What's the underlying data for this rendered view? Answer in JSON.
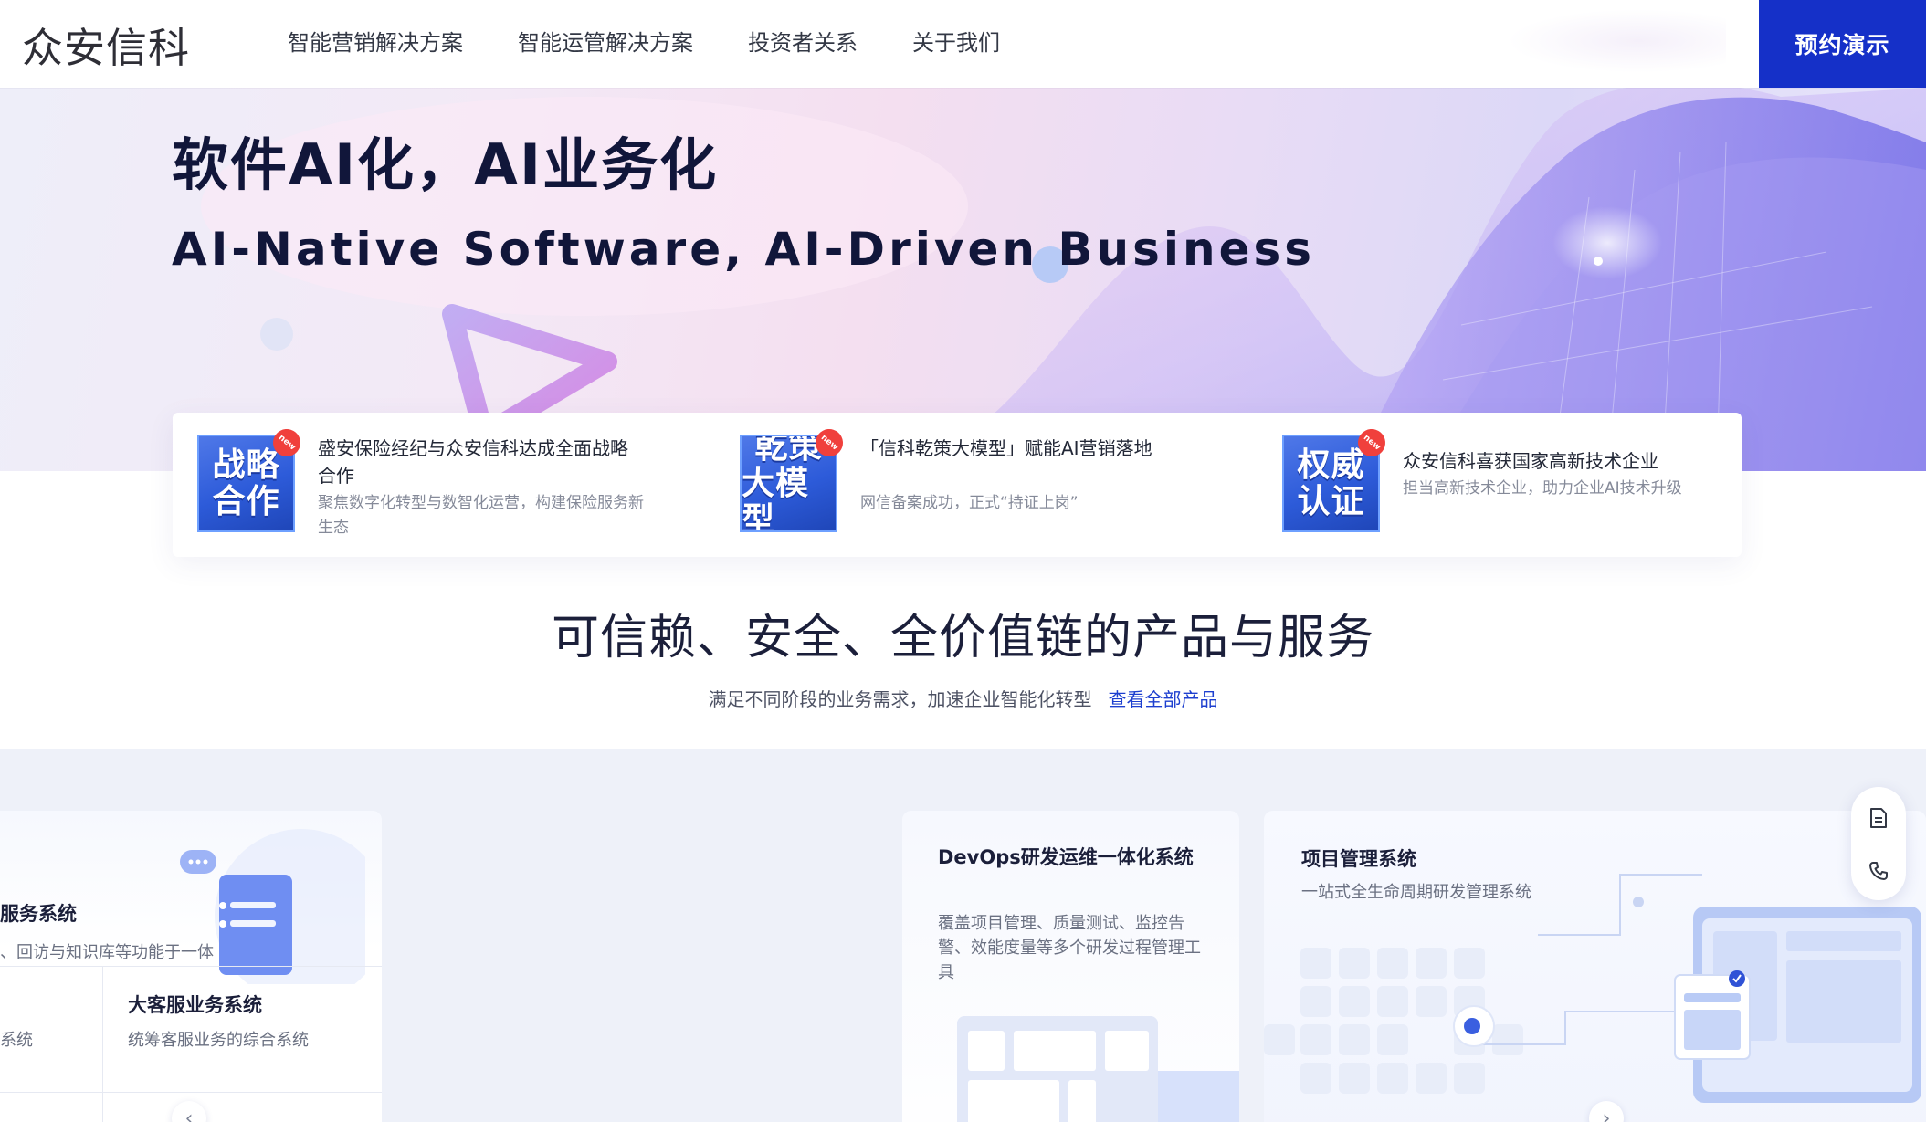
{
  "header": {
    "logo": "众安信科",
    "nav": [
      "智能营销解决方案",
      "智能运管解决方案",
      "投资者关系",
      "关于我们"
    ],
    "demo_button": "预约演示"
  },
  "hero": {
    "title": "软件AI化，AI业务化",
    "subtitle": "AI-Native Software, AI-Driven Business"
  },
  "news": [
    {
      "thumb": [
        "战略",
        "合作"
      ],
      "tag": "new",
      "title": "盛安保险经纪与众安信科达成全面战略合作",
      "desc": "聚焦数字化转型与数智化运营，构建保险服务新生态"
    },
    {
      "thumb": [
        "乾策",
        "大模型"
      ],
      "tag": "new",
      "title": "「信科乾策大模型」赋能AI营销落地",
      "desc": "网信备案成功，正式“持证上岗”"
    },
    {
      "thumb": [
        "权威",
        "认证"
      ],
      "tag": "new",
      "title": "众安信科喜获国家高新技术企业",
      "desc": "担当高新技术企业，助力企业AI技术升级"
    }
  ],
  "section": {
    "title": "可信赖、安全、全价值链的产品与服务",
    "subtitle": "满足不同阶段的业务需求，加速企业智能化转型",
    "link": "查看全部产品"
  },
  "products": {
    "card_a": {
      "title": "服务系统",
      "desc": "、回访与知识库等功能于一体",
      "sub_left_desc": "系统",
      "sub_right_title": "大客服业务系统",
      "sub_right_desc": "统筹客服业务的综合系统"
    },
    "card_b": {
      "title": "DevOps研发运维一体化系统",
      "desc": "覆盖项目管理、质量测试、监控告警、效能度量等多个研发过程管理工具"
    },
    "card_c": {
      "title": "项目管理系统",
      "desc": "一站式全生命周期研发管理系统"
    },
    "prev_icon": "chevron-left-icon",
    "next_icon": "chevron-right-icon"
  },
  "floating": {
    "icons": [
      "document-icon",
      "phone-icon"
    ]
  },
  "colors": {
    "brand": "#1530c8",
    "link": "#1d3fcf",
    "tag": "#f0403c"
  }
}
